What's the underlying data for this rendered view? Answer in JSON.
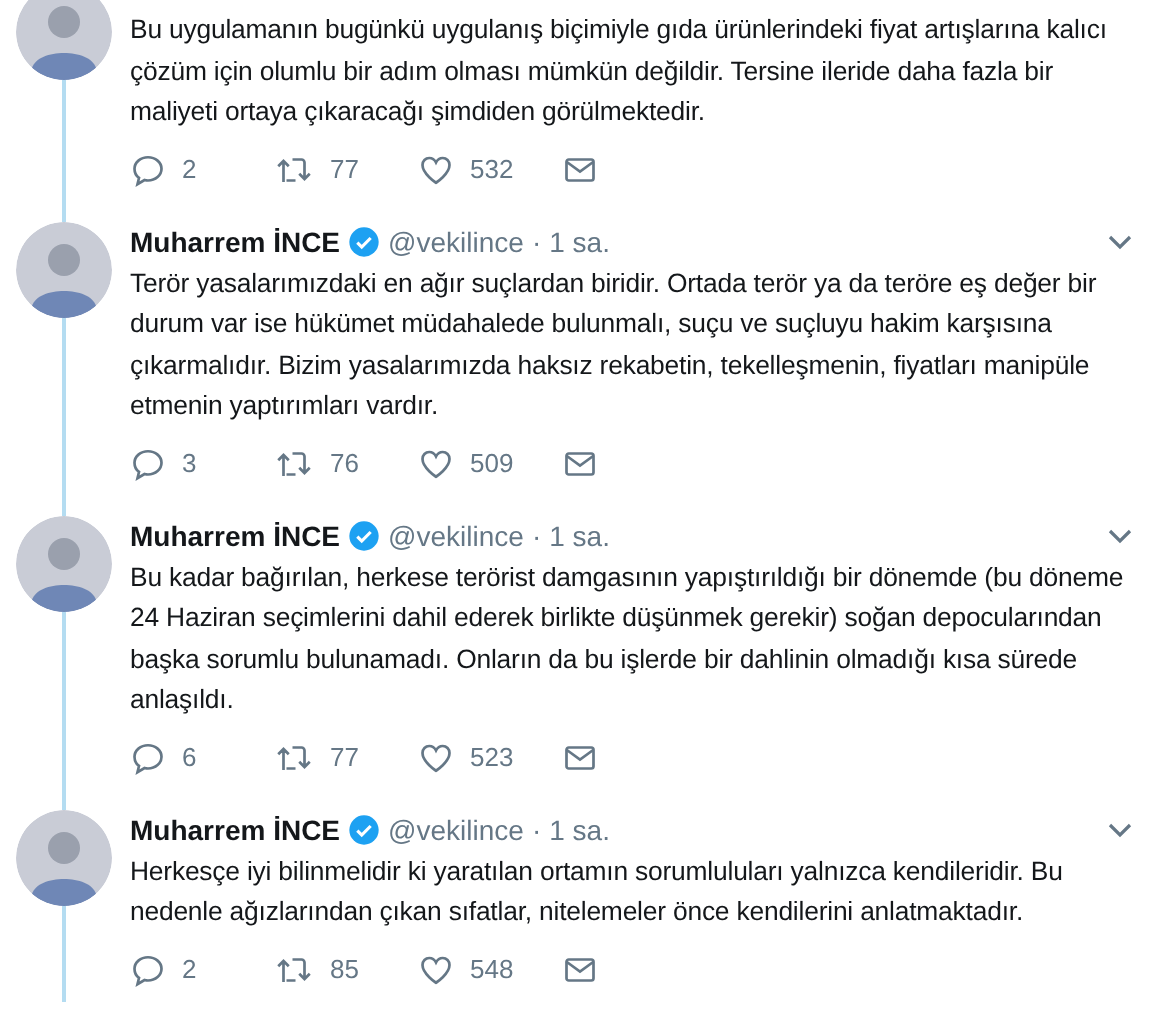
{
  "tweets": [
    {
      "text": "Bu uygulamanın bugünkü uygulanış biçimiyle gıda ürünlerindeki fiyat artışlarına kalıcı çözüm için olumlu bir adım olması mümkün değildir. Tersine ileride daha fazla bir maliyeti ortaya çıkaracağı şimdiden görülmektedir.",
      "replies": "2",
      "retweets": "77",
      "likes": "532"
    },
    {
      "author": "Muharrem İNCE",
      "verified": true,
      "handle": "@vekilince",
      "separator": "·",
      "time": "1 sa.",
      "text": "Terör yasalarımızdaki en ağır suçlardan biridir. Ortada terör ya da teröre eş değer bir durum var ise hükümet müdahalede bulunmalı, suçu ve suçluyu hakim karşısına çıkarmalıdır. Bizim yasalarımızda haksız rekabetin, tekelleşmenin, fiyatları manipüle etmenin yaptırımları vardır.",
      "replies": "3",
      "retweets": "76",
      "likes": "509"
    },
    {
      "author": "Muharrem İNCE",
      "verified": true,
      "handle": "@vekilince",
      "separator": "·",
      "time": "1 sa.",
      "text": "Bu kadar bağırılan, herkese terörist damgasının yapıştırıldığı bir dönemde (bu döneme 24 Haziran seçimlerini dahil ederek birlikte düşünmek gerekir) soğan depocularından başka sorumlu bulunamadı. Onların da bu işlerde bir dahlinin olmadığı kısa sürede anlaşıldı.",
      "replies": "6",
      "retweets": "77",
      "likes": "523"
    },
    {
      "author": "Muharrem İNCE",
      "verified": true,
      "handle": "@vekilince",
      "separator": "·",
      "time": "1 sa.",
      "text": "Herkesçe iyi bilinmelidir ki yaratılan ortamın sorumluluları yalnızca kendileridir. Bu nedenle ağızlarından çıkan sıfatlar, nitelemeler önce kendilerini anlatmaktadır.",
      "replies": "2",
      "retweets": "85",
      "likes": "548"
    }
  ]
}
